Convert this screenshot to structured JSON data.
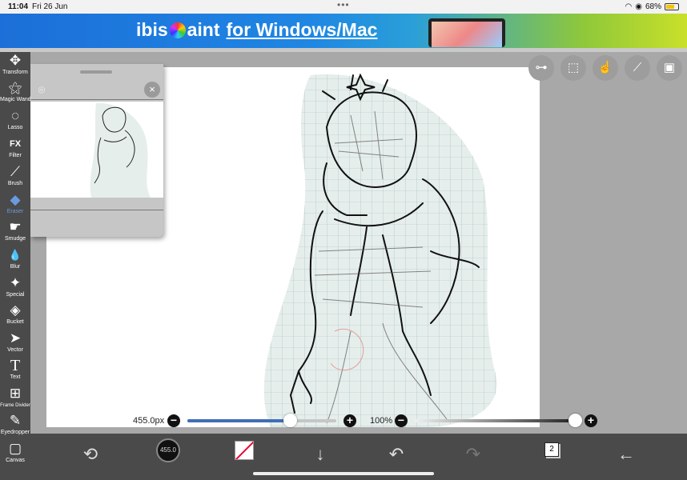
{
  "status": {
    "time": "11:04",
    "date": "Fri 26 Jun",
    "battery": "68%",
    "battery_level": 0.68
  },
  "banner": {
    "brand": "ibisPaint",
    "brand_a": "ibis",
    "brand_b": "aint",
    "tagline": "for Windows/Mac"
  },
  "tools": [
    {
      "label": "Transform",
      "icon": "move-icon",
      "glyph": "✥"
    },
    {
      "label": "Magic Wand",
      "icon": "magic-wand-icon",
      "glyph": "⚝"
    },
    {
      "label": "Lasso",
      "icon": "lasso-icon",
      "glyph": "◌"
    },
    {
      "label": "Filter",
      "icon": "fx-icon",
      "glyph": "FX"
    },
    {
      "label": "Brush",
      "icon": "brush-icon",
      "glyph": "⟋"
    },
    {
      "label": "Eraser",
      "icon": "eraser-icon",
      "glyph": "◆",
      "active": true
    },
    {
      "label": "Smudge",
      "icon": "smudge-icon",
      "glyph": "☛"
    },
    {
      "label": "Blur",
      "icon": "blur-icon",
      "glyph": "💧"
    },
    {
      "label": "Special",
      "icon": "special-icon",
      "glyph": "✦"
    },
    {
      "label": "Bucket",
      "icon": "bucket-icon",
      "glyph": "◈"
    },
    {
      "label": "Vector",
      "icon": "vector-icon",
      "glyph": "➤"
    },
    {
      "label": "Text",
      "icon": "text-icon",
      "glyph": "T"
    },
    {
      "label": "Frame Divider",
      "icon": "frame-divider-icon",
      "glyph": "⊞"
    },
    {
      "label": "Eyedropper",
      "icon": "eyedropper-icon",
      "glyph": "✎"
    },
    {
      "label": "Canvas",
      "icon": "canvas-icon",
      "glyph": "▢"
    }
  ],
  "navigator": {
    "camera_icon": "camera-icon",
    "close_icon": "close-icon",
    "close_glyph": "×",
    "camera_glyph": "⌾"
  },
  "top_icons": [
    {
      "name": "toggle-icon",
      "glyph": "⊶"
    },
    {
      "name": "selection-icon",
      "glyph": "⬚"
    },
    {
      "name": "touch-icon",
      "glyph": "☝"
    },
    {
      "name": "ruler-icon",
      "glyph": "⟋"
    },
    {
      "name": "reference-image-icon",
      "glyph": "▣"
    }
  ],
  "sliders": {
    "size_label": "455.0px",
    "size_value": 455.0,
    "size_fraction": 0.69,
    "opacity_label": "100%",
    "opacity_value": 100,
    "minus": "−",
    "plus": "+"
  },
  "bottom": {
    "brush_size_label": "455.0",
    "layer_count": "2",
    "icons": [
      "swap-tool-icon",
      "brush-size-icon",
      "color-icon",
      "download-icon",
      "undo-icon",
      "redo-icon",
      "layers-icon",
      "back-icon"
    ],
    "glyphs": {
      "swap": "⟲",
      "download": "↓",
      "undo": "↶",
      "redo": "↷",
      "back": "←"
    }
  },
  "colors": {
    "toolbar": "#4a4a4a",
    "accent": "#6a9be0",
    "size_track": "#3f6fb4"
  }
}
